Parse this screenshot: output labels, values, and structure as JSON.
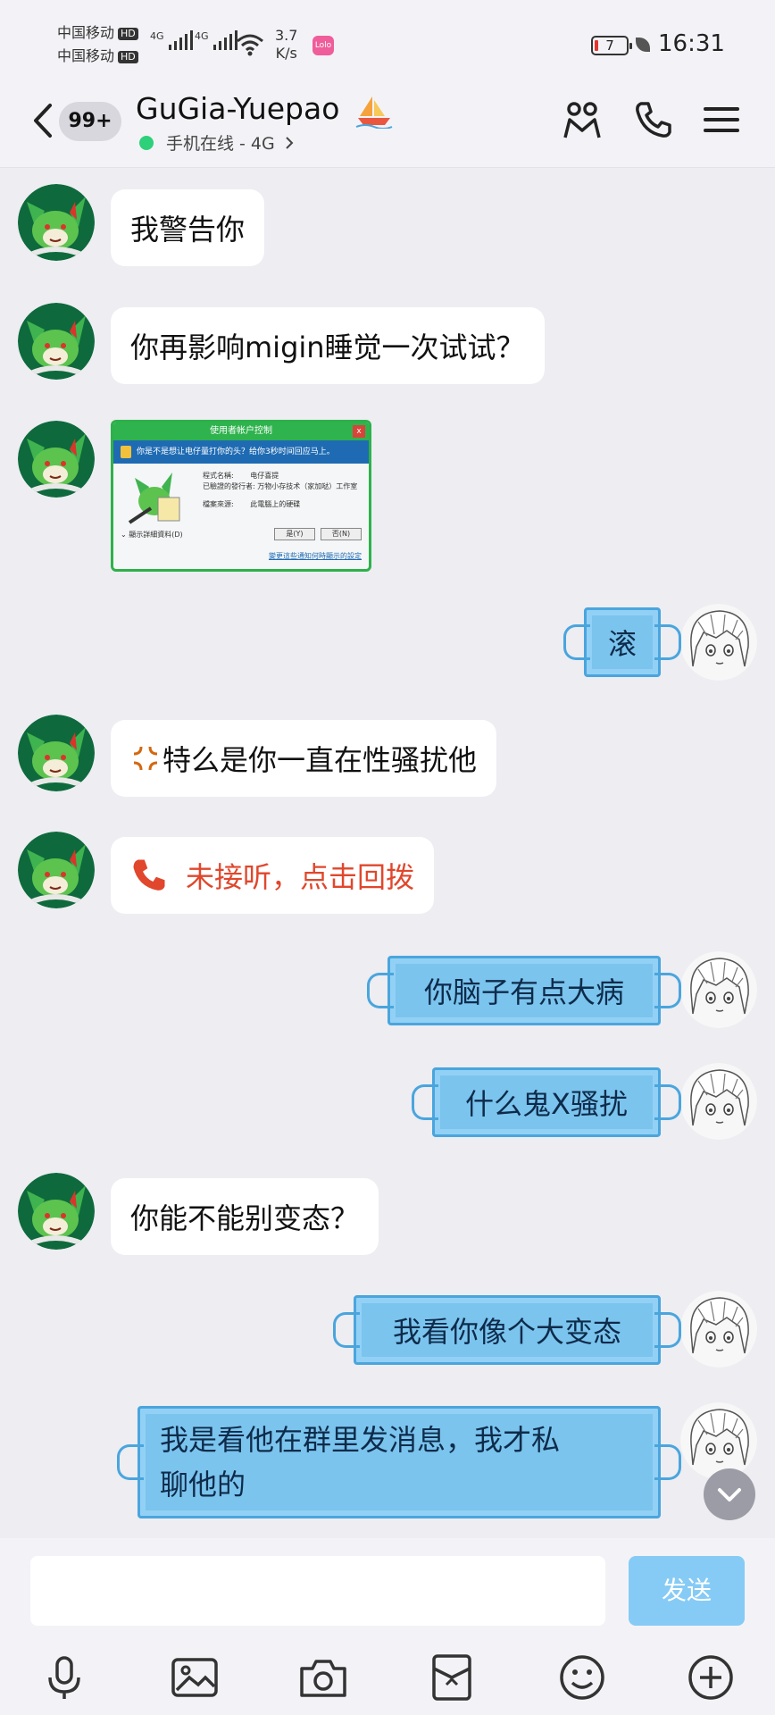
{
  "status": {
    "carrier1": "中国移动",
    "carrier2": "中国移动",
    "hd": "HD",
    "net1": "4G",
    "net2": "4G",
    "speed_value": "3.7",
    "speed_unit": "K/s",
    "app_badge": "Lolo",
    "battery": "7",
    "time": "16:31"
  },
  "header": {
    "unread_count": "99+",
    "contact_name": "GuGia-Yuepao",
    "online_status": "手机在线 - 4G"
  },
  "messages": [
    {
      "side": "in",
      "text": "我警告你"
    },
    {
      "side": "in",
      "text": "你再影响migin睡觉一次试试？"
    },
    {
      "side": "in",
      "type": "image"
    },
    {
      "side": "out",
      "text": "滚"
    },
    {
      "side": "in",
      "text": "特么是你一直在性骚扰他",
      "prefix_icon": "anger-symbol-icon"
    },
    {
      "side": "in",
      "text": "未接听，点击回拨",
      "type": "missed-call"
    },
    {
      "side": "out",
      "text": "你脑子有点大病"
    },
    {
      "side": "out",
      "text": "什么鬼X骚扰"
    },
    {
      "side": "in",
      "text": "你能不能别变态？"
    },
    {
      "side": "out",
      "text": "我看你像个大变态"
    },
    {
      "side": "out",
      "text_line1": "我是看他在群里发消息，我才私",
      "text_line2": "聊他的"
    }
  ],
  "image_message": {
    "window_title": "使用者帐户控制",
    "banner": "你是不是想让电仔量打你的头？给你3秒时间回应马上。",
    "program_name_label": "程式名稱:",
    "program_name_value": "电仔喜提",
    "publisher_label": "已驗證的發行者:",
    "publisher_value": "万物小存技术（家加哒）工作室",
    "origin_label": "檔案來源:",
    "origin_value": "此電腦上的硬碟",
    "details_label": "顯示詳細資料(D)",
    "yes_button": "是(Y)",
    "no_button": "否(N)",
    "link": "變更這些通知何時顯示的設定"
  },
  "input": {
    "send_label": "发送"
  },
  "colors": {
    "outgoing_bubble": "#7bc4ee",
    "missed_call": "#e0472c",
    "online_dot": "#2ed07a",
    "send_button": "#86cbf5"
  }
}
